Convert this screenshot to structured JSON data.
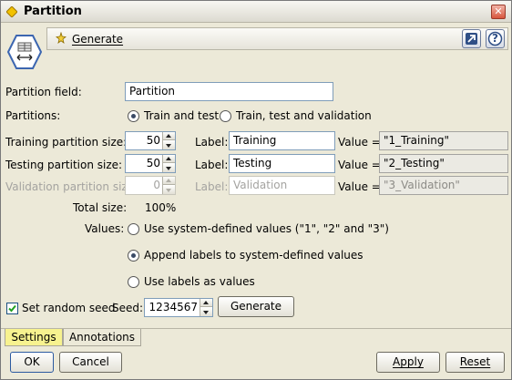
{
  "window": {
    "title": "Partition",
    "close_glyph": "✕"
  },
  "toolbar": {
    "generate_label": "Generate",
    "help_glyph": "?"
  },
  "form": {
    "partition_field_label": "Partition field:",
    "partition_field_value": "Partition",
    "partitions_label": "Partitions:",
    "partitions_options": [
      "Train and test",
      "Train, test and validation"
    ],
    "partitions_selected": 0,
    "training": {
      "label": "Training partition size:",
      "size": "50",
      "label_caption": "Label:",
      "label_value": "Training",
      "value_caption": "Value =",
      "value": "\"1_Training\""
    },
    "testing": {
      "label": "Testing partition size:",
      "size": "50",
      "label_caption": "Label:",
      "label_value": "Testing",
      "value_caption": "Value =",
      "value": "\"2_Testing\""
    },
    "validation": {
      "label": "Validation partition size:",
      "size": "0",
      "label_caption": "Label:",
      "label_value": "Validation",
      "value_caption": "Value =",
      "value": "\"3_Validation\""
    },
    "total_size_label": "Total size:",
    "total_size_value": "100%",
    "values_label": "Values:",
    "values_options": [
      "Use system-defined values (\"1\", \"2\" and \"3\")",
      "Append labels to system-defined values",
      "Use labels as values"
    ],
    "values_selected": 1,
    "seed_checkbox_label": "Set random seed",
    "seed_checked": true,
    "seed_label": "Seed:",
    "seed_value": "1234567",
    "generate_button": "Generate"
  },
  "tabs": [
    {
      "label": "Settings",
      "active": true
    },
    {
      "label": "Annotations",
      "active": false
    }
  ],
  "footer": {
    "ok": "OK",
    "cancel": "Cancel",
    "apply": "Apply",
    "reset": "Reset"
  },
  "colors": {
    "active_tab": "#f7f28f",
    "window_bg": "#ece9d8"
  }
}
